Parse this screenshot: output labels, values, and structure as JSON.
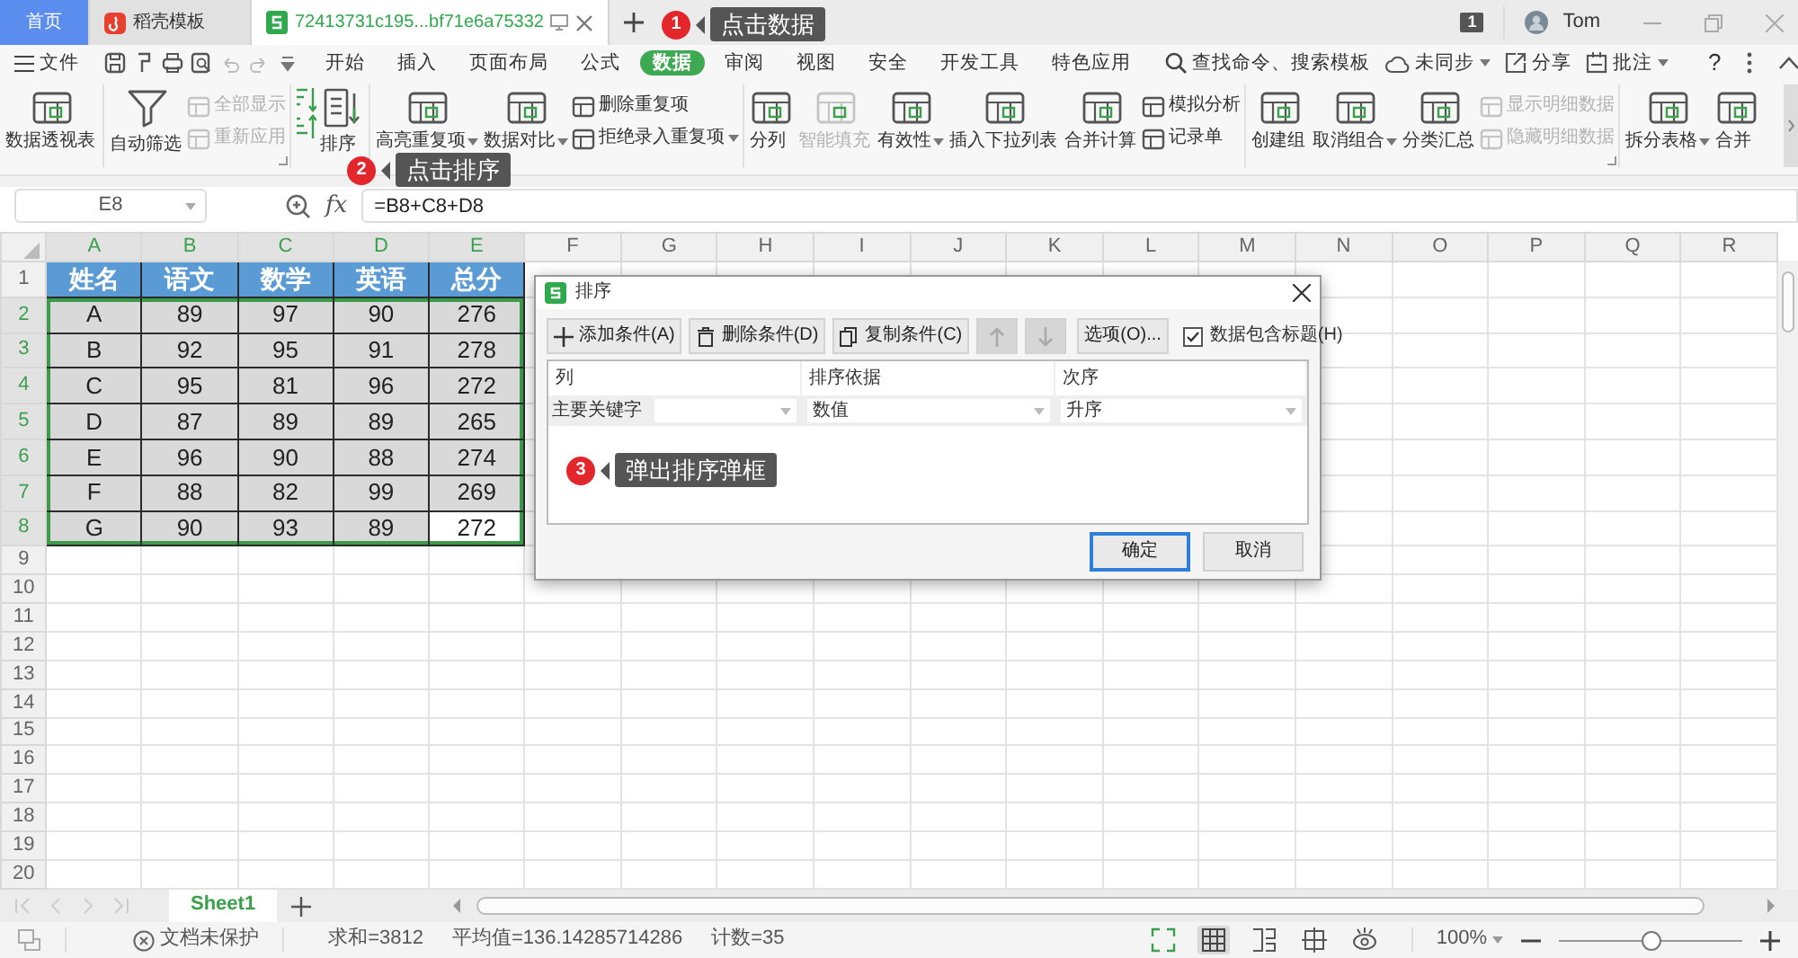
{
  "tabs": [
    {
      "kind": "home",
      "label": "首页",
      "selected": false
    },
    {
      "kind": "template",
      "label": "稻壳模板",
      "selected": false
    },
    {
      "kind": "document",
      "label": "72413731c195...bf71e6a75332",
      "selected": true
    }
  ],
  "account": {
    "badge": "1",
    "user": "Tom"
  },
  "callouts": [
    {
      "number": "1",
      "text": "点击数据"
    },
    {
      "number": "2",
      "text": "点击排序"
    },
    {
      "number": "3",
      "text": "弹出排序弹框"
    }
  ],
  "menu": {
    "file": "文件",
    "tabs": [
      {
        "label": "开始",
        "selected": false
      },
      {
        "label": "插入",
        "selected": false
      },
      {
        "label": "页面布局",
        "selected": false
      },
      {
        "label": "公式",
        "selected": false
      },
      {
        "label": "数据",
        "selected": true
      },
      {
        "label": "审阅",
        "selected": false
      },
      {
        "label": "视图",
        "selected": false
      },
      {
        "label": "安全",
        "selected": false
      },
      {
        "label": "开发工具",
        "selected": false
      },
      {
        "label": "特色应用",
        "selected": false
      }
    ],
    "search": "查找命令、搜索模板",
    "sync": "未同步",
    "share": "分享",
    "comment": "批注",
    "help": "?"
  },
  "ribbon": [
    {
      "launcher": false,
      "items": [
        {
          "kind": "large",
          "label": "数据透视表",
          "disabled": false,
          "dropdown": false
        }
      ]
    },
    {
      "launcher": true,
      "items": [
        {
          "kind": "large",
          "label": "自动筛选",
          "disabled": false,
          "dropdown": false
        },
        {
          "kind": "stack",
          "items": [
            {
              "label": "全部显示",
              "disabled": true,
              "dropdown": false
            },
            {
              "label": "重新应用",
              "disabled": true,
              "dropdown": false
            }
          ]
        }
      ]
    },
    {
      "launcher": false,
      "items": [
        {
          "kind": "sort_icons"
        },
        {
          "kind": "large",
          "label": "排序",
          "disabled": false,
          "dropdown": false
        }
      ]
    },
    {
      "launcher": false,
      "items": [
        {
          "kind": "large",
          "label": "高亮重复项",
          "disabled": false,
          "dropdown": true
        },
        {
          "kind": "large",
          "label": "数据对比",
          "disabled": false,
          "dropdown": true
        },
        {
          "kind": "stack",
          "items": [
            {
              "label": "删除重复项",
              "disabled": false,
              "dropdown": false
            },
            {
              "label": "拒绝录入重复项",
              "disabled": false,
              "dropdown": true
            }
          ]
        }
      ]
    },
    {
      "launcher": false,
      "items": [
        {
          "kind": "large",
          "label": "分列",
          "disabled": false,
          "dropdown": false
        },
        {
          "kind": "large",
          "label": "智能填充",
          "disabled": true,
          "dropdown": false
        },
        {
          "kind": "large",
          "label": "有效性",
          "disabled": false,
          "dropdown": true
        },
        {
          "kind": "large",
          "label": "插入下拉列表",
          "disabled": false,
          "dropdown": false
        },
        {
          "kind": "large",
          "label": "合并计算",
          "disabled": false,
          "dropdown": false
        },
        {
          "kind": "stack",
          "items": [
            {
              "label": "模拟分析",
              "disabled": false,
              "dropdown": false
            },
            {
              "label": "记录单",
              "disabled": false,
              "dropdown": false
            }
          ]
        }
      ]
    },
    {
      "launcher": true,
      "items": [
        {
          "kind": "large",
          "label": "创建组",
          "disabled": false,
          "dropdown": false
        },
        {
          "kind": "large",
          "label": "取消组合",
          "disabled": false,
          "dropdown": true
        },
        {
          "kind": "large",
          "label": "分类汇总",
          "disabled": false,
          "dropdown": false
        },
        {
          "kind": "stack",
          "items": [
            {
              "label": "显示明细数据",
              "disabled": true,
              "dropdown": false
            },
            {
              "label": "隐藏明细数据",
              "disabled": true,
              "dropdown": false
            }
          ]
        }
      ]
    },
    {
      "launcher": false,
      "items": [
        {
          "kind": "large",
          "label": "拆分表格",
          "disabled": false,
          "dropdown": true
        },
        {
          "kind": "large",
          "label": "合并",
          "disabled": false,
          "dropdown": false
        }
      ]
    }
  ],
  "formula_bar": {
    "name_box": "E8",
    "fx": "fx",
    "formula": "=B8+C8+D8"
  },
  "sheet": {
    "columns": [
      {
        "label": "A",
        "selected": true
      },
      {
        "label": "B",
        "selected": true
      },
      {
        "label": "C",
        "selected": true
      },
      {
        "label": "D",
        "selected": true
      },
      {
        "label": "E",
        "selected": true
      },
      {
        "label": "F",
        "selected": false
      },
      {
        "label": "G",
        "selected": false
      },
      {
        "label": "H",
        "selected": false
      },
      {
        "label": "I",
        "selected": false
      },
      {
        "label": "J",
        "selected": false
      },
      {
        "label": "K",
        "selected": false
      },
      {
        "label": "L",
        "selected": false
      },
      {
        "label": "M",
        "selected": false
      },
      {
        "label": "N",
        "selected": false
      },
      {
        "label": "O",
        "selected": false
      },
      {
        "label": "P",
        "selected": false
      },
      {
        "label": "Q",
        "selected": false
      },
      {
        "label": "R",
        "selected": false
      }
    ],
    "rows": [
      {
        "number": "1",
        "selected": false,
        "kind": "header",
        "cells": [
          {
            "text": "姓名",
            "active": false
          },
          {
            "text": "语文",
            "active": false
          },
          {
            "text": "数学",
            "active": false
          },
          {
            "text": "英语",
            "active": false
          },
          {
            "text": "总分",
            "active": false
          }
        ]
      },
      {
        "number": "2",
        "selected": true,
        "kind": "data",
        "cells": [
          {
            "text": "A",
            "active": false
          },
          {
            "text": "89",
            "active": false
          },
          {
            "text": "97",
            "active": false
          },
          {
            "text": "90",
            "active": false
          },
          {
            "text": "276",
            "active": false
          }
        ]
      },
      {
        "number": "3",
        "selected": true,
        "kind": "data",
        "cells": [
          {
            "text": "B",
            "active": false
          },
          {
            "text": "92",
            "active": false
          },
          {
            "text": "95",
            "active": false
          },
          {
            "text": "91",
            "active": false
          },
          {
            "text": "278",
            "active": false
          }
        ]
      },
      {
        "number": "4",
        "selected": true,
        "kind": "data",
        "cells": [
          {
            "text": "C",
            "active": false
          },
          {
            "text": "95",
            "active": false
          },
          {
            "text": "81",
            "active": false
          },
          {
            "text": "96",
            "active": false
          },
          {
            "text": "272",
            "active": false
          }
        ]
      },
      {
        "number": "5",
        "selected": true,
        "kind": "data",
        "cells": [
          {
            "text": "D",
            "active": false
          },
          {
            "text": "87",
            "active": false
          },
          {
            "text": "89",
            "active": false
          },
          {
            "text": "89",
            "active": false
          },
          {
            "text": "265",
            "active": false
          }
        ]
      },
      {
        "number": "6",
        "selected": true,
        "kind": "data",
        "cells": [
          {
            "text": "E",
            "active": false
          },
          {
            "text": "96",
            "active": false
          },
          {
            "text": "90",
            "active": false
          },
          {
            "text": "88",
            "active": false
          },
          {
            "text": "274",
            "active": false
          }
        ]
      },
      {
        "number": "7",
        "selected": true,
        "kind": "data",
        "cells": [
          {
            "text": "F",
            "active": false
          },
          {
            "text": "88",
            "active": false
          },
          {
            "text": "82",
            "active": false
          },
          {
            "text": "99",
            "active": false
          },
          {
            "text": "269",
            "active": false
          }
        ]
      },
      {
        "number": "8",
        "selected": true,
        "kind": "data",
        "cells": [
          {
            "text": "G",
            "active": false
          },
          {
            "text": "90",
            "active": false
          },
          {
            "text": "93",
            "active": false
          },
          {
            "text": "89",
            "active": false
          },
          {
            "text": "272",
            "active": true
          }
        ]
      },
      {
        "number": "9",
        "selected": false
      },
      {
        "number": "10",
        "selected": false
      },
      {
        "number": "11",
        "selected": false
      },
      {
        "number": "12",
        "selected": false
      },
      {
        "number": "13",
        "selected": false
      },
      {
        "number": "14",
        "selected": false
      },
      {
        "number": "15",
        "selected": false
      },
      {
        "number": "16",
        "selected": false
      },
      {
        "number": "17",
        "selected": false
      },
      {
        "number": "18",
        "selected": false
      },
      {
        "number": "19",
        "selected": false
      },
      {
        "number": "20",
        "selected": false
      }
    ]
  },
  "sheet_tabs": [
    {
      "label": "Sheet1",
      "selected": true
    }
  ],
  "status_bar": {
    "protection": "文档未保护",
    "stats": [
      "求和=3812",
      "平均值=136.14285714286",
      "计数=35"
    ],
    "view_modes": [
      {
        "selected": false
      },
      {
        "selected": true
      },
      {
        "selected": false
      },
      {
        "selected": false
      },
      {
        "selected": false
      }
    ],
    "zoom": "100%",
    "zoom_slider": {
      "level": 0.5
    }
  },
  "sort_dialog": {
    "title": "排序",
    "toolbar": [
      {
        "kind": "add",
        "label": "添加条件(A)",
        "disabled": false
      },
      {
        "kind": "delete",
        "label": "删除条件(D)",
        "disabled": false
      },
      {
        "kind": "copy",
        "label": "复制条件(C)",
        "disabled": false
      },
      {
        "kind": "move_up",
        "disabled": true
      },
      {
        "kind": "move_down",
        "disabled": true
      },
      {
        "kind": "options",
        "label": "选项(O)...",
        "disabled": false
      }
    ],
    "has_header": {
      "label": "数据包含标题(H)",
      "checked": true
    },
    "columns": [
      "列",
      "排序依据",
      "次序"
    ],
    "rows": [
      {
        "label": "主要关键字",
        "sort_on": "数值",
        "order": "升序"
      }
    ],
    "buttons": [
      {
        "label": "确定",
        "default": true
      },
      {
        "label": "取消",
        "default": false
      }
    ]
  }
}
